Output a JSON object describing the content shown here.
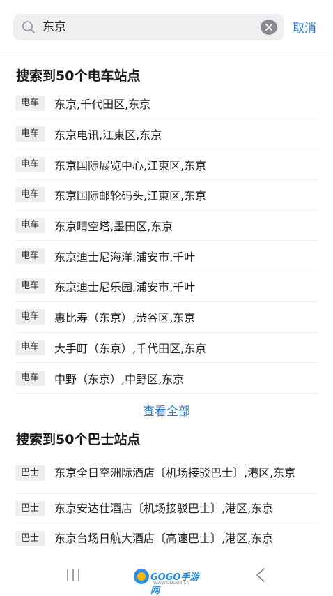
{
  "search": {
    "value": "东京"
  },
  "header": {
    "cancel_label": "取消"
  },
  "tram_section": {
    "title": "搜索到50个电车站点",
    "tag": "电车",
    "items": [
      "东京,千代田区,东京",
      "东京电讯,江東区,东京",
      "东京国际展览中心,江東区,东京",
      "东京国际邮轮码头,江東区,东京",
      "东京晴空塔,墨田区,东京",
      "东京迪士尼海洋,浦安市,千叶",
      "东京迪士尼乐园,浦安市,千叶",
      "惠比寿（东京）,渋谷区,东京",
      "大手町（东京）,千代田区,东京",
      "中野（东京）,中野区,东京"
    ],
    "view_all": "查看全部"
  },
  "bus_section": {
    "title": "搜索到50个巴士站点",
    "tag": "巴士",
    "items": [
      "东京全日空洲际酒店〔机场接驳巴士〕,港区,东京",
      "东京安达仕酒店〔机场接驳巴士〕,港区,东京",
      "东京台场日航大酒店〔高速巴士〕,港区,东京"
    ]
  },
  "footer": {
    "logo_text": "GOGO手游网",
    "logo_sub": "WWW.GOGO9.CN"
  },
  "colors": {
    "accent": "#2e7fd1",
    "tag_bg": "#eeeeee"
  }
}
